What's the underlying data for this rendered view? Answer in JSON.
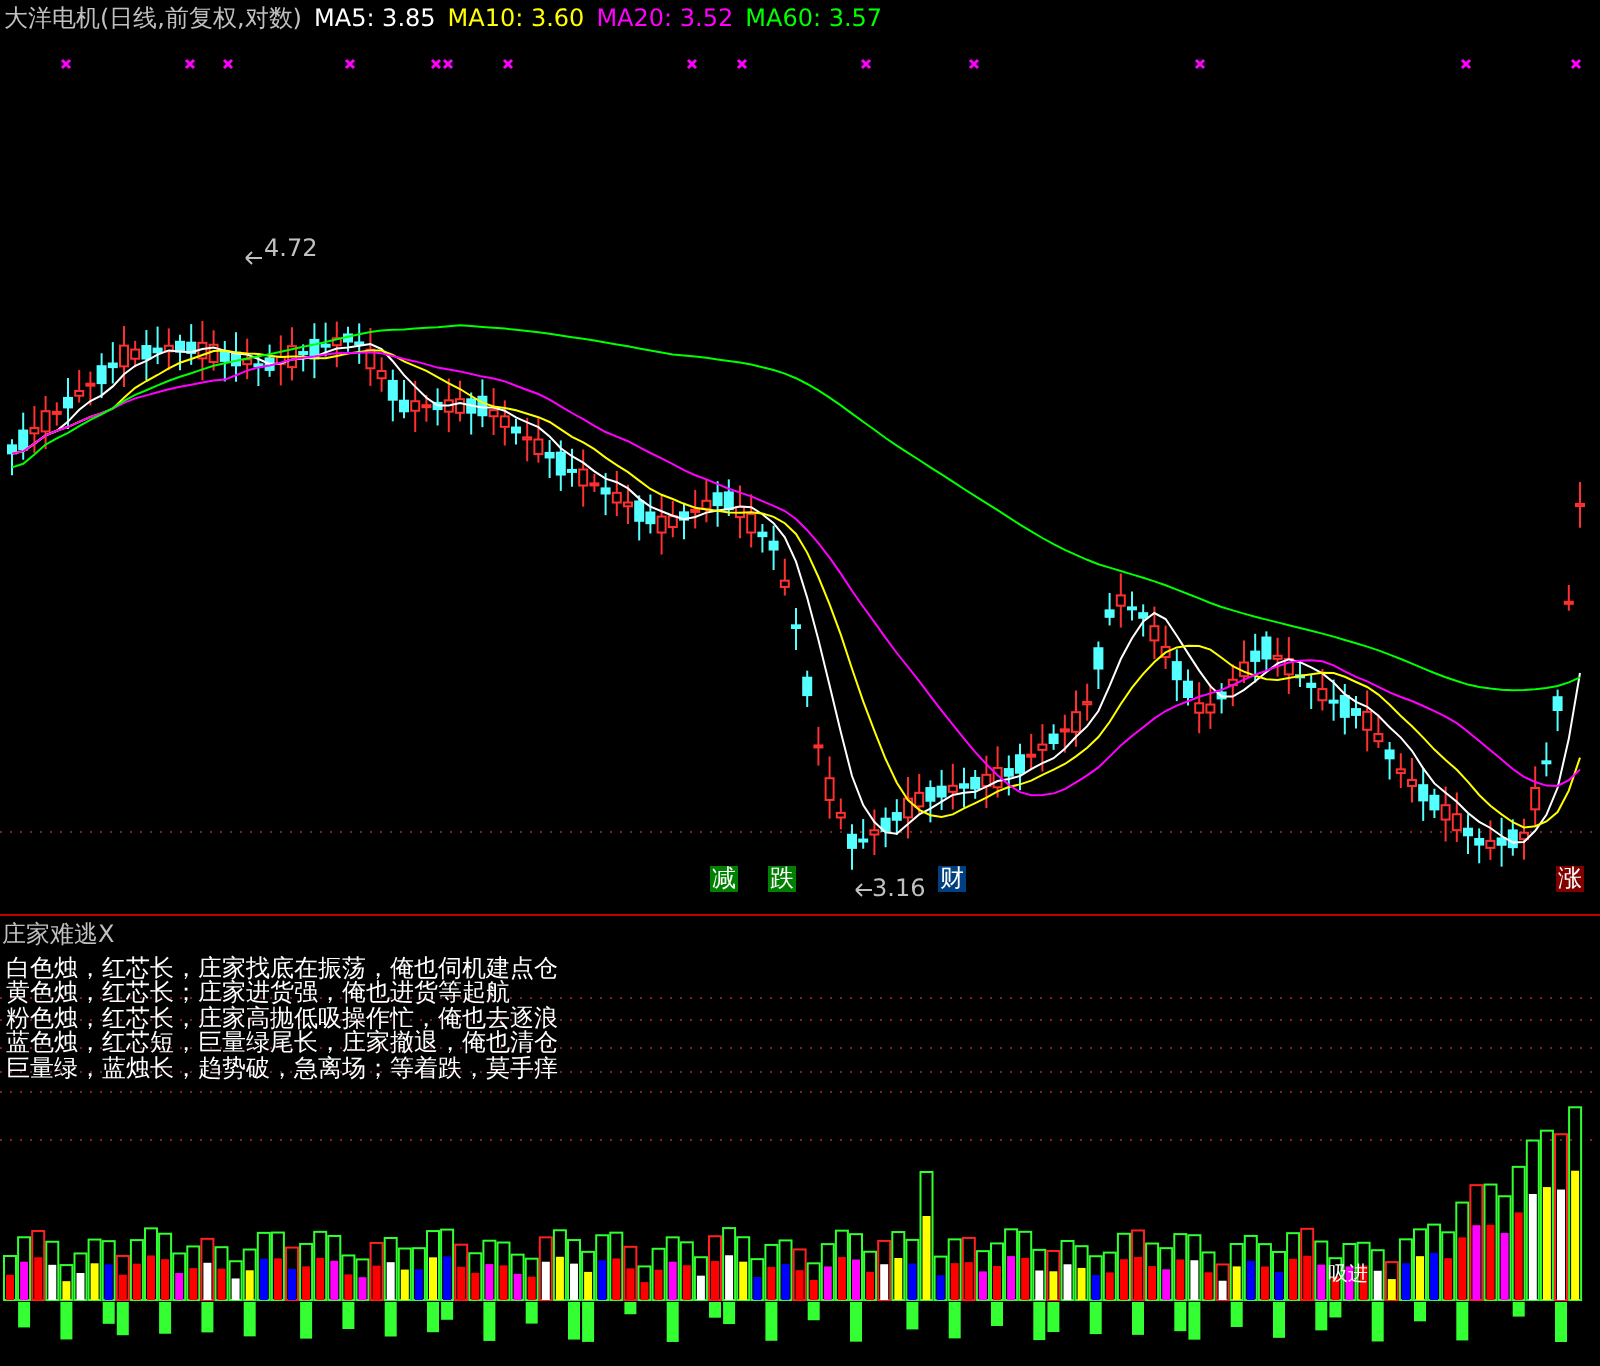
{
  "title": "大洋电机(日线,前复权,对数)",
  "moving_averages": [
    {
      "label": "MA5:",
      "value": "3.85",
      "color": "#ffffff"
    },
    {
      "label": "MA10:",
      "value": "3.60",
      "color": "#ffff00"
    },
    {
      "label": "MA20:",
      "value": "3.52",
      "color": "#ff00ff"
    },
    {
      "label": "MA60:",
      "value": "3.57",
      "color": "#00ff00"
    }
  ],
  "price_labels": [
    {
      "kind": "high",
      "text": "4.72"
    },
    {
      "kind": "low",
      "text": "3.16"
    }
  ],
  "signal_marks": [
    {
      "text": "减",
      "color": "#008000"
    },
    {
      "text": "跌",
      "color": "#008000"
    },
    {
      "text": "财",
      "color": "#004080"
    },
    {
      "text": "涨",
      "color": "#800000"
    }
  ],
  "indicator": {
    "title": "庄家难逃X",
    "legend": [
      "白色烛，红芯长，庄家找底在振荡，俺也伺机建点仓",
      "黄色烛，红芯长；庄家进货强，俺也进货等起航",
      "粉色烛，红芯长，庄家高抛低吸操作忙，俺也去逐浪",
      "蓝色烛，红芯短，巨量绿尾长，庄家撤退，俺也清仓",
      "巨量绿，蓝烛长，趋势破，急离场；等着跌，莫手痒"
    ],
    "tag": "吸进"
  }
}
